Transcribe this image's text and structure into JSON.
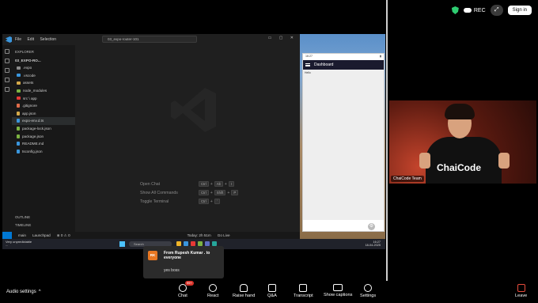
{
  "top_right": {
    "rec_label": "REC",
    "signin_label": "Sign in"
  },
  "vscode": {
    "menu": [
      "File",
      "Edit",
      "Selection"
    ],
    "search": "03_expo-router-101",
    "explorer_title": "EXPLORER",
    "root_folder": "03_EXPO-RO...",
    "tree": [
      {
        "name": ".expo",
        "type": "folder",
        "color": "#8c8c8c"
      },
      {
        "name": ".vscode",
        "type": "folder",
        "color": "#3a96dd"
      },
      {
        "name": "assets",
        "type": "folder",
        "color": "#d4a94a"
      },
      {
        "name": "node_modules",
        "type": "folder",
        "color": "#7cb342"
      },
      {
        "name": "src \\ app",
        "type": "folder",
        "color": "#e53935"
      },
      {
        "name": ".gitignore",
        "type": "file",
        "color": "#e06c4a"
      },
      {
        "name": "app.json",
        "type": "file",
        "color": "#d4a94a"
      },
      {
        "name": "expo-env.d.ts",
        "type": "file",
        "color": "#3a96dd"
      },
      {
        "name": "package-lock.json",
        "type": "file",
        "color": "#7cb342"
      },
      {
        "name": "package.json",
        "type": "file",
        "color": "#7cb342"
      },
      {
        "name": "README.md",
        "type": "file",
        "color": "#3a96dd"
      },
      {
        "name": "tsconfig.json",
        "type": "file",
        "color": "#3a96dd"
      }
    ],
    "outline_label": "OUTLINE",
    "timeline_label": "TIMELINE",
    "shortcuts": [
      {
        "label": "Open Chat",
        "keys": [
          "Ctrl",
          "+",
          "Alt",
          "+",
          "I"
        ]
      },
      {
        "label": "Show All Commands",
        "keys": [
          "Ctrl",
          "+",
          "Shift",
          "+",
          "P"
        ]
      },
      {
        "label": "Toggle Terminal",
        "keys": [
          "Ctrl",
          "+",
          "`"
        ]
      }
    ],
    "status": {
      "branch": "main",
      "launchpad": "Launchpad",
      "problems": "⊗ 0 ⚠ 0",
      "today": "Today: 2h 51m",
      "golive": "Go Live"
    }
  },
  "phone": {
    "time": "16:27",
    "appbar_title": "Dashboard",
    "body_text": "Hello"
  },
  "taskbar": {
    "weather_line1": "Very unpredictable",
    "weather_line2": "...",
    "search": "Search",
    "time": "16:27",
    "date": "18-04-2025"
  },
  "participant": {
    "name": "ChaiCode Team",
    "shirt_logo": "ChaiCode"
  },
  "chat_toast": {
    "avatar": "RK",
    "from": "From Rupesh Kumar . to everyone",
    "message": "yes boss"
  },
  "toolbar": {
    "audio_label": "Audio settings",
    "chat_label": "Chat",
    "chat_badge": "99+",
    "react_label": "React",
    "raise_label": "Raise hand",
    "qa_label": "Q&A",
    "transcript_label": "Transcript",
    "captions_label": "Show captions",
    "settings_label": "Settings",
    "leave_label": "Leave"
  }
}
